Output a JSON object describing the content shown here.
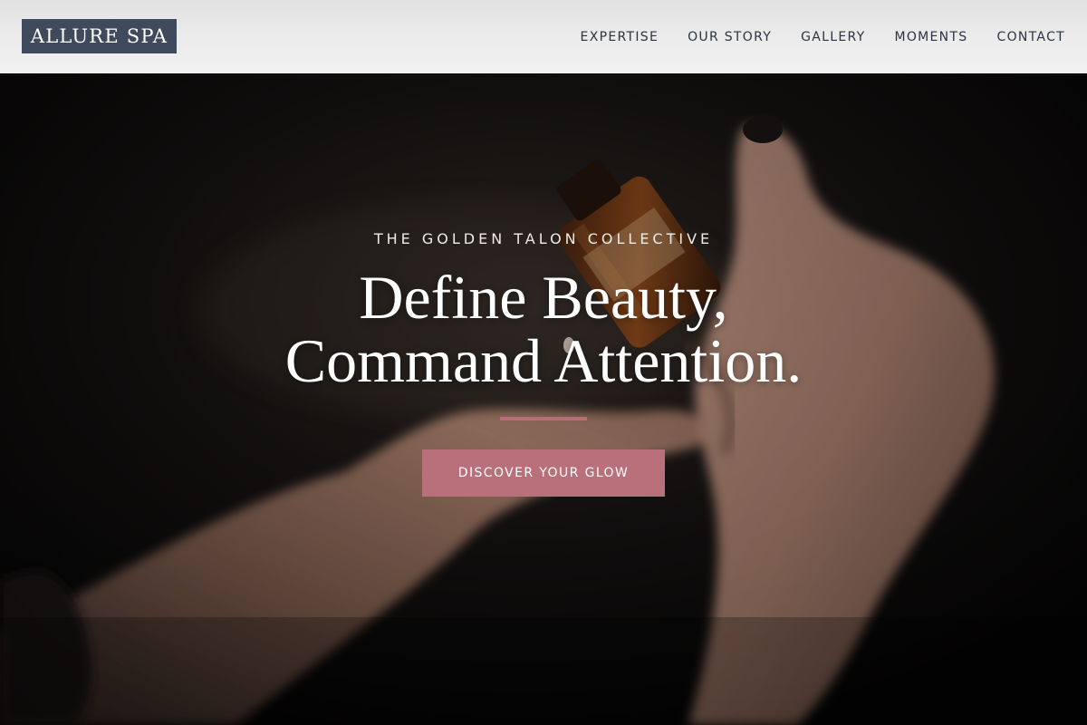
{
  "brand": {
    "name": "ALLURE SPA",
    "logo_bg_color": "#3f4a5c"
  },
  "nav": {
    "items": [
      {
        "label": "EXPERTISE"
      },
      {
        "label": "OUR STORY"
      },
      {
        "label": "GALLERY"
      },
      {
        "label": "MOMENTS"
      },
      {
        "label": "CONTACT"
      }
    ]
  },
  "hero": {
    "eyebrow": "THE GOLDEN TALON COLLECTIVE",
    "headline_line1": "Define Beauty,",
    "headline_line2": "Command Attention.",
    "cta_label": "DISCOVER YOUR GLOW",
    "accent_color": "#b76e79",
    "background_image": "photo of hands pouring from an amber dropper bottle"
  }
}
